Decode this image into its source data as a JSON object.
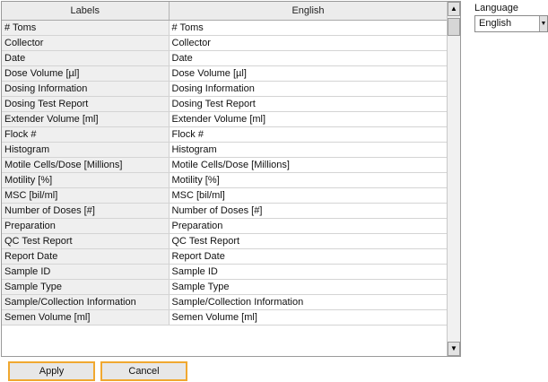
{
  "table": {
    "columns": [
      "Labels",
      "English"
    ],
    "rows": [
      [
        "# Toms",
        "# Toms"
      ],
      [
        "Collector",
        "Collector"
      ],
      [
        "Date",
        "Date"
      ],
      [
        "Dose Volume [µl]",
        "Dose Volume [µl]"
      ],
      [
        "Dosing Information",
        "Dosing Information"
      ],
      [
        "Dosing Test Report",
        "Dosing Test Report"
      ],
      [
        "Extender Volume [ml]",
        "Extender Volume [ml]"
      ],
      [
        "Flock #",
        "Flock #"
      ],
      [
        "Histogram",
        "Histogram"
      ],
      [
        "Motile Cells/Dose [Millions]",
        "Motile Cells/Dose [Millions]"
      ],
      [
        "Motility [%]",
        "Motility [%]"
      ],
      [
        "MSC [bil/ml]",
        "MSC [bil/ml]"
      ],
      [
        "Number of Doses [#]",
        "Number of Doses [#]"
      ],
      [
        "Preparation",
        "Preparation"
      ],
      [
        "QC Test Report",
        "QC Test Report"
      ],
      [
        "Report Date",
        "Report Date"
      ],
      [
        "Sample ID",
        "Sample ID"
      ],
      [
        "Sample Type",
        "Sample Type"
      ],
      [
        "Sample/Collection Information",
        "Sample/Collection Information"
      ],
      [
        "Semen Volume [ml]",
        "Semen Volume [ml]"
      ]
    ]
  },
  "language": {
    "label": "Language",
    "selected": "English"
  },
  "buttons": {
    "apply": "Apply",
    "cancel": "Cancel"
  },
  "icons": {
    "scroll_up": "scroll-up-arrow-icon",
    "scroll_down": "scroll-down-arrow-icon",
    "dropdown": "dropdown-arrow-icon"
  },
  "colors": {
    "button_border": "#f0a830",
    "label_cell_bg": "#efefef",
    "header_bg": "#ececec"
  }
}
